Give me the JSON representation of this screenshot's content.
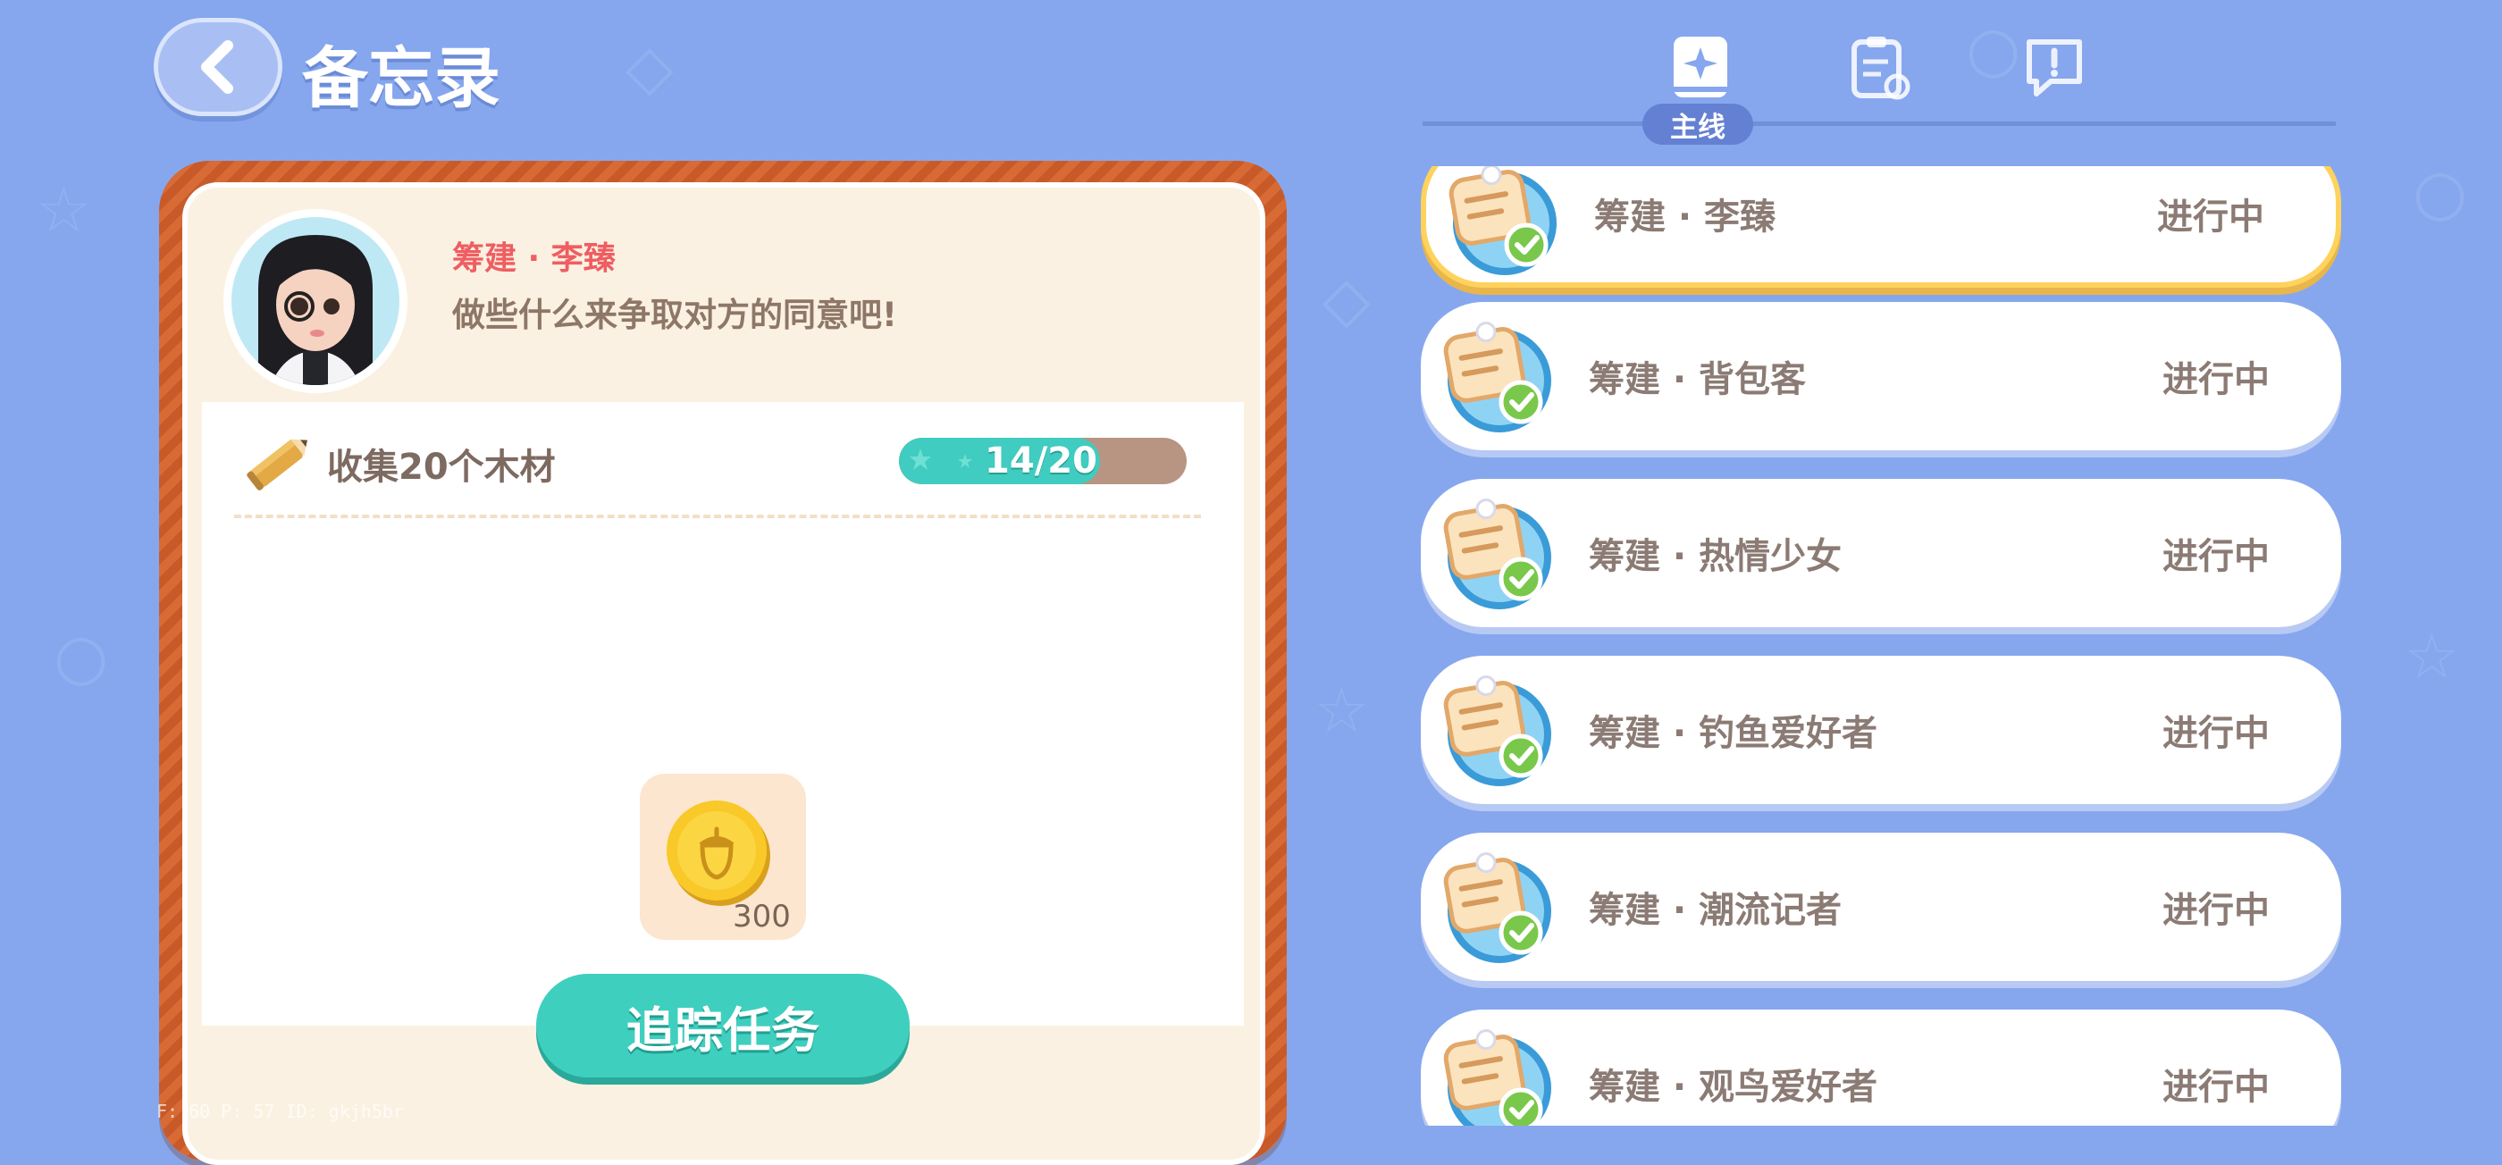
{
  "colors": {
    "background": "#86a7ee",
    "panel_border": "#d86a35",
    "accent_teal": "#40ccc0",
    "selected_border": "#ffd25c",
    "npc_name": "#ee5e62"
  },
  "header": {
    "title": "备忘录",
    "back_icon": "back-arrow-icon"
  },
  "tabs": [
    {
      "icon": "main-quest-book-icon",
      "label": "主线",
      "active": true
    },
    {
      "icon": "clipboard-refresh-icon",
      "active": false
    },
    {
      "icon": "feedback-bubble-icon",
      "active": false
    }
  ],
  "quest_detail": {
    "npc_name": "筹建 · 李臻",
    "description": "做些什么来争取对方的同意吧!",
    "task": {
      "icon": "pencil-icon",
      "text": "收集20个木材",
      "current": 14,
      "total": 20,
      "progress_label": "14/20"
    },
    "reward": {
      "icon": "acorn-coin-icon",
      "count": "300"
    },
    "track_button": "追踪任务"
  },
  "quest_list": [
    {
      "name": "筹建 · 李臻",
      "status": "进行中",
      "selected": true
    },
    {
      "name": "筹建 · 背包客",
      "status": "进行中",
      "selected": false
    },
    {
      "name": "筹建 · 热情少女",
      "status": "进行中",
      "selected": false
    },
    {
      "name": "筹建 · 钓鱼爱好者",
      "status": "进行中",
      "selected": false
    },
    {
      "name": "筹建 · 潮流记者",
      "status": "进行中",
      "selected": false
    },
    {
      "name": "筹建 · 观鸟爱好者",
      "status": "进行中",
      "selected": false
    }
  ],
  "debug": "F: 60   P: 57   ID: gkjh5br"
}
